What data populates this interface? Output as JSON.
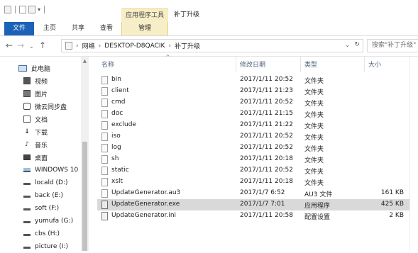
{
  "titlebar": {
    "context_tab": "应用程序工具",
    "window_title": "补丁升级"
  },
  "ribbon": {
    "file_tab": "文件",
    "tabs": [
      "主页",
      "共享",
      "查看"
    ],
    "manage_tab": "管理"
  },
  "address": {
    "crumbs": [
      "网络",
      "DESKTOP-D8QACIK",
      "补丁升级"
    ],
    "search_placeholder": "搜索\"补丁升级\""
  },
  "nav": {
    "items": [
      {
        "label": "此电脑",
        "icon": "computer-icon"
      },
      {
        "label": "视频",
        "icon": "video-icon"
      },
      {
        "label": "图片",
        "icon": "pictures-icon"
      },
      {
        "label": "微云同步盘",
        "icon": "cloud-sync-icon"
      },
      {
        "label": "文档",
        "icon": "documents-icon"
      },
      {
        "label": "下载",
        "icon": "download-icon"
      },
      {
        "label": "音乐",
        "icon": "music-icon"
      },
      {
        "label": "桌面",
        "icon": "desktop-icon"
      },
      {
        "label": "WINDOWS 10",
        "icon": "system-drive-icon"
      },
      {
        "label": "locald (D:)",
        "icon": "drive-icon"
      },
      {
        "label": "back (E:)",
        "icon": "drive-icon"
      },
      {
        "label": "soft (F:)",
        "icon": "drive-icon"
      },
      {
        "label": "yumufa (G:)",
        "icon": "drive-icon"
      },
      {
        "label": "cbs (H:)",
        "icon": "drive-icon"
      },
      {
        "label": "picture (I:)",
        "icon": "drive-icon"
      }
    ]
  },
  "columns": {
    "name": "名称",
    "modified": "修改日期",
    "type": "类型",
    "size": "大小"
  },
  "files": [
    {
      "name": "bin",
      "modified": "2017/1/11 20:52",
      "type": "文件夹",
      "size": "",
      "icon": "folder-icon"
    },
    {
      "name": "client",
      "modified": "2017/1/11 21:23",
      "type": "文件夹",
      "size": "",
      "icon": "folder-icon"
    },
    {
      "name": "cmd",
      "modified": "2017/1/11 20:52",
      "type": "文件夹",
      "size": "",
      "icon": "folder-icon"
    },
    {
      "name": "doc",
      "modified": "2017/1/11 21:15",
      "type": "文件夹",
      "size": "",
      "icon": "folder-icon"
    },
    {
      "name": "exclude",
      "modified": "2017/1/11 21:22",
      "type": "文件夹",
      "size": "",
      "icon": "folder-icon"
    },
    {
      "name": "iso",
      "modified": "2017/1/11 20:52",
      "type": "文件夹",
      "size": "",
      "icon": "folder-icon"
    },
    {
      "name": "log",
      "modified": "2017/1/11 20:52",
      "type": "文件夹",
      "size": "",
      "icon": "folder-icon"
    },
    {
      "name": "sh",
      "modified": "2017/1/11 20:18",
      "type": "文件夹",
      "size": "",
      "icon": "folder-icon"
    },
    {
      "name": "static",
      "modified": "2017/1/11 20:52",
      "type": "文件夹",
      "size": "",
      "icon": "folder-icon"
    },
    {
      "name": "xslt",
      "modified": "2017/1/11 20:18",
      "type": "文件夹",
      "size": "",
      "icon": "folder-icon"
    },
    {
      "name": "UpdateGenerator.au3",
      "modified": "2017/1/7 6:52",
      "type": "AU3 文件",
      "size": "161 KB",
      "icon": "au3-file-icon"
    },
    {
      "name": "UpdateGenerator.exe",
      "modified": "2017/1/7 7:01",
      "type": "应用程序",
      "size": "425 KB",
      "icon": "exe-file-icon",
      "selected": true
    },
    {
      "name": "UpdateGenerator.ini",
      "modified": "2017/1/11 20:58",
      "type": "配置设置",
      "size": "2 KB",
      "icon": "ini-file-icon"
    }
  ],
  "colors": {
    "file_tab": "#1c62b8",
    "context_tab": "#f7edc6",
    "selected_row": "#d9d9d9"
  }
}
